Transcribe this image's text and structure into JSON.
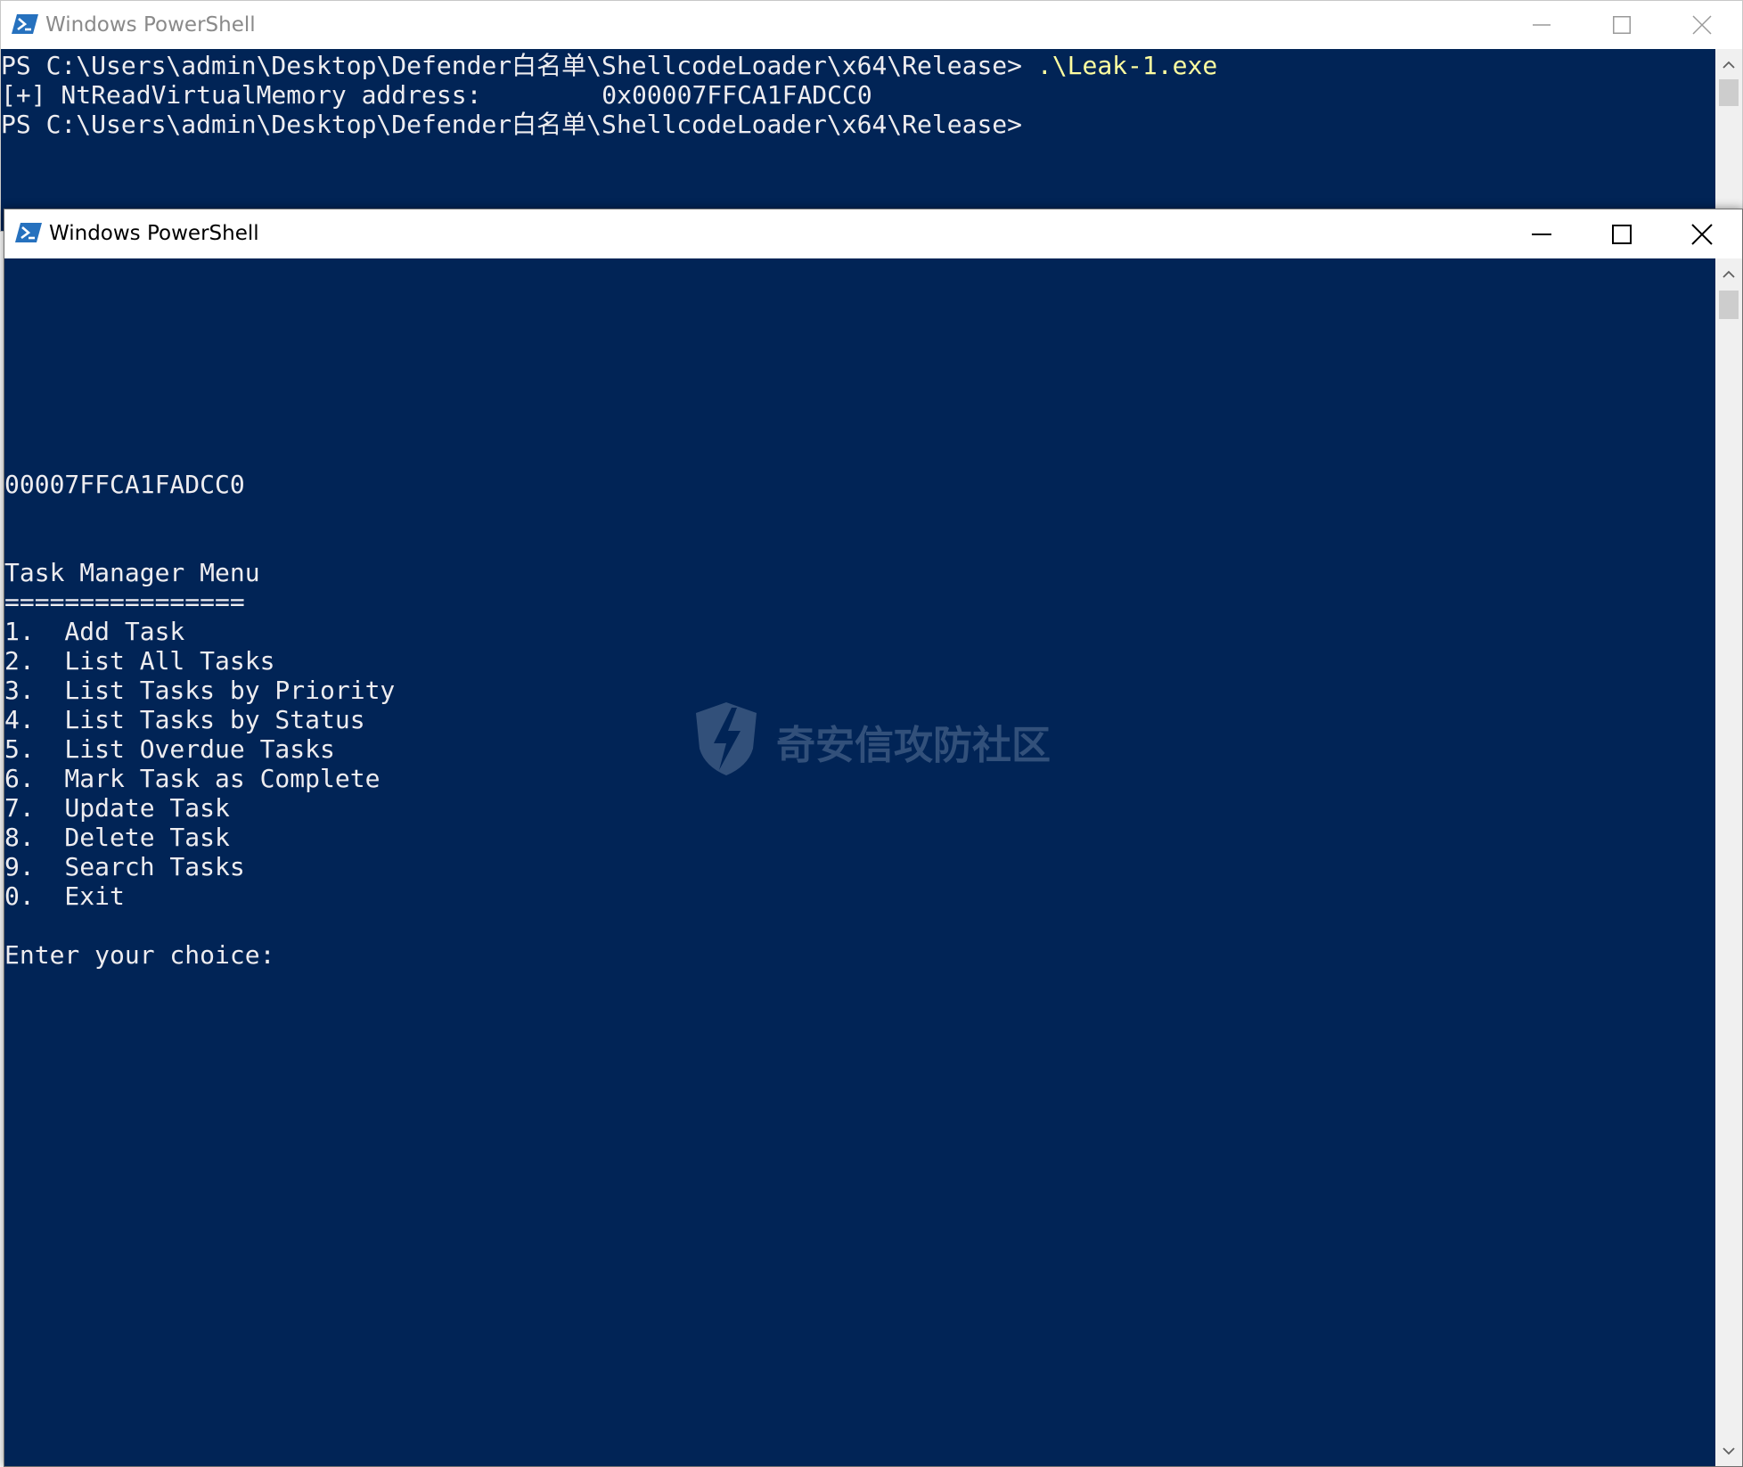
{
  "colors": {
    "console_background": "#012456",
    "console_text": "#eeedf0",
    "command_highlight": "#fefea0",
    "titlebar_background": "#ffffff",
    "inactive_title_text": "#8a8a8a",
    "scrollbar_track": "#f0f0f0",
    "scrollbar_thumb": "#cdcdcd"
  },
  "icons": {
    "app": "powershell-icon",
    "minimize": "minimize-icon",
    "maximize": "maximize-icon",
    "close": "close-icon",
    "scroll_up": "chevron-up-icon",
    "scroll_down": "chevron-down-icon",
    "watermark": "shield-bolt-logo"
  },
  "back_window": {
    "title": "Windows PowerShell",
    "state": "inactive",
    "lines": [
      {
        "prompt": "PS C:\\Users\\admin\\Desktop\\Defender白名单\\ShellcodeLoader\\x64\\Release> ",
        "command": ".\\Leak-1.exe"
      },
      {
        "text": "[+] NtReadVirtualMemory address:        0x00007FFCA1FADCC0"
      },
      {
        "prompt": "PS C:\\Users\\admin\\Desktop\\Defender白名单\\ShellcodeLoader\\x64\\Release>"
      }
    ]
  },
  "front_window": {
    "title": "Windows PowerShell",
    "state": "active",
    "lines": [
      "00007FFCA1FADCC0",
      "",
      "",
      "Task Manager Menu",
      "================",
      "1.  Add Task",
      "2.  List All Tasks",
      "3.  List Tasks by Priority",
      "4.  List Tasks by Status",
      "5.  List Overdue Tasks",
      "6.  Mark Task as Complete",
      "7.  Update Task",
      "8.  Delete Task",
      "9.  Search Tasks",
      "0.  Exit",
      "",
      "Enter your choice:"
    ]
  },
  "watermark": {
    "text": "奇安信攻防社区"
  }
}
